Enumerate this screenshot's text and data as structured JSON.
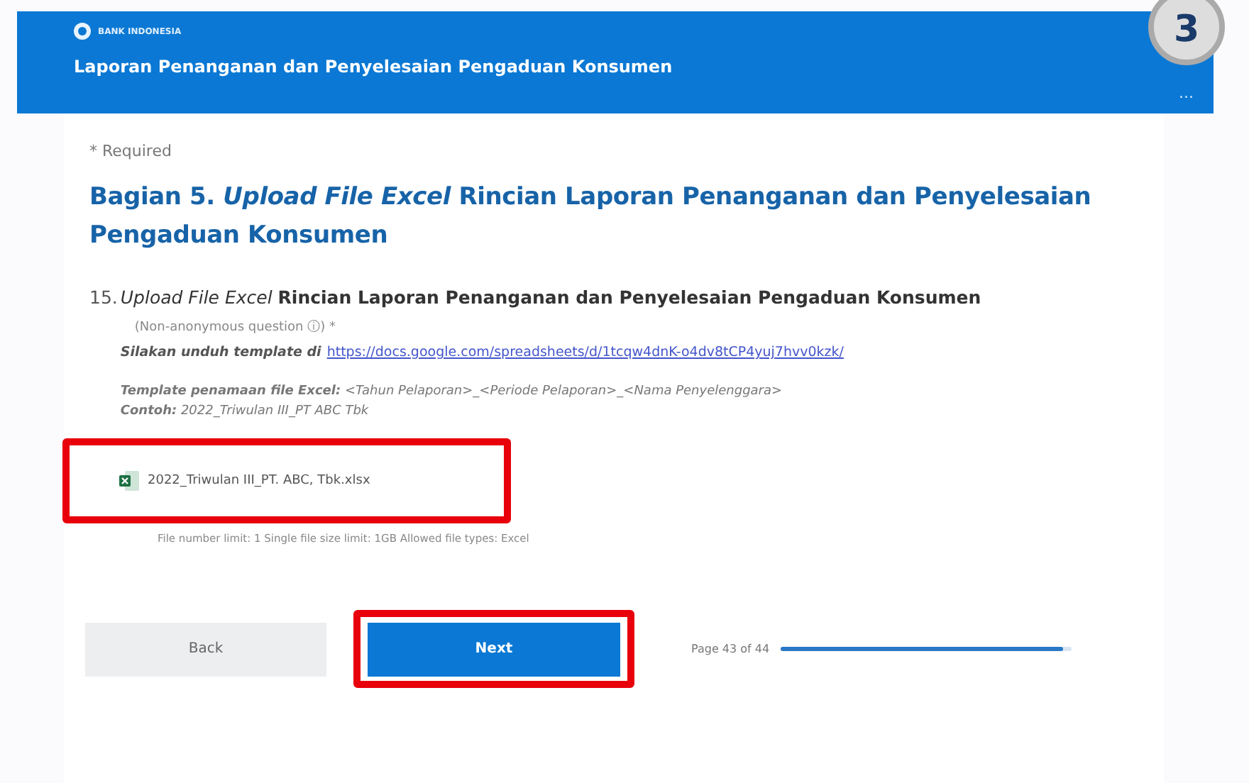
{
  "header": {
    "logo_text": "BANK INDONESIA",
    "title": "Laporan Penanganan dan Penyelesaian Pengaduan Konsumen",
    "menu": "..."
  },
  "step_badge": "3",
  "required_note": "* Required",
  "section_title": "Bagian 5. *Upload File Excel* Rincian Laporan Penanganan dan Penyelesaian Pengaduan Konsumen",
  "question": {
    "number": "15.",
    "title": "*Upload File Excel* **Rincian Laporan Penanganan dan Penyelesaian Pengaduan Konsumen**",
    "anonymity": "(Non-anonymous question ⓘ) *",
    "download_prompt": "Silakan unduh template di",
    "link": "https://docs.google.com/spreadsheets/d/1tcqw4dnK-o4dv8tCP4yuj7hvv0kzk/",
    "naming_rule": "**Template penamaan file Excel:** <Tahun Pelaporan>_<Periode Pelaporan>_<Nama Penyelenggara>",
    "example": "**Contoh:** 2022_Triwulan III_PT ABC Tbk",
    "file": {
      "name": "2022_Triwulan III_PT. ABC, Tbk.xlsx",
      "highlighted": true
    },
    "limits": "File number limit: 1   Single file size limit: 1GB   Allowed file types: Excel"
  },
  "footer": {
    "back": "Back",
    "next": {
      "label": "Next",
      "highlighted": true
    },
    "page": "Page 43 of 44",
    "level": 0.97
  }
}
